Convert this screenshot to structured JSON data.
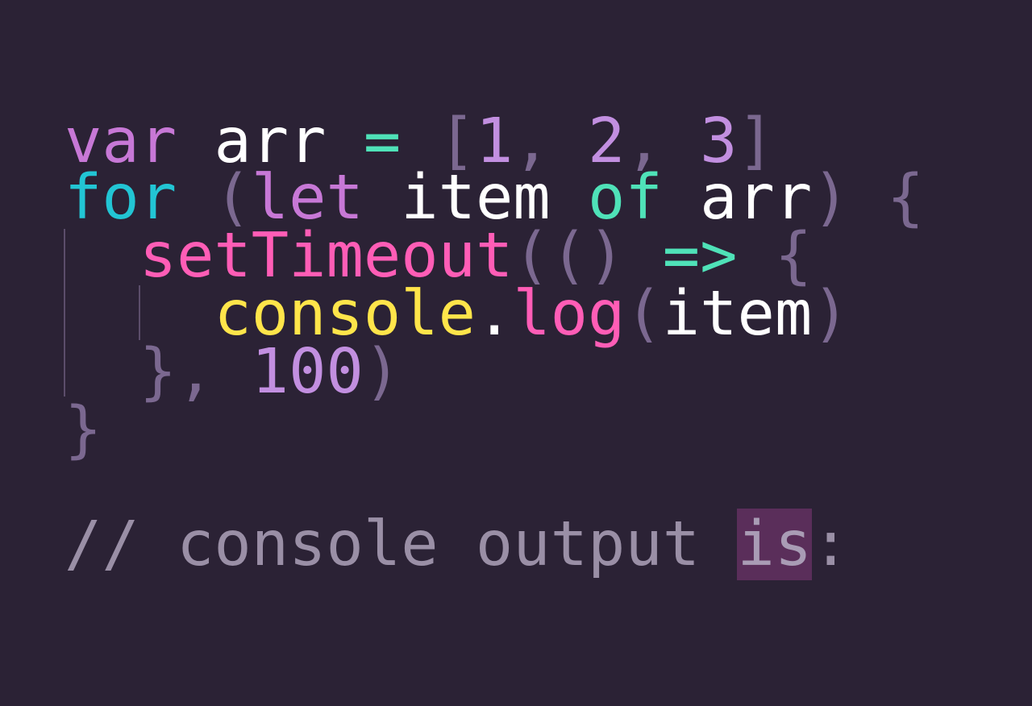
{
  "editor": {
    "background": "#2b2235",
    "code": {
      "line1": {
        "kw": "var",
        "s1": " ",
        "name": "arr",
        "s2": " ",
        "op": "=",
        "s3": " ",
        "lb": "[",
        "n1": "1",
        "c1": ", ",
        "n2": "2",
        "c2": ", ",
        "n3": "3",
        "rb": "]"
      },
      "line2": {
        "kw": "for",
        "s1": " ",
        "lp": "(",
        "let": "let",
        "s2": " ",
        "item": "item",
        "s3": " ",
        "of": "of",
        "s4": " ",
        "arr": "arr",
        "rp": ")",
        "s5": " ",
        "lb": "{"
      },
      "line3": {
        "indent": "  ",
        "fn": "setTimeout",
        "p1": "((",
        "p2": ")",
        "s1": " ",
        "arrow": "=>",
        "s2": " ",
        "lb": "{"
      },
      "line4": {
        "indent": "    ",
        "obj": "console",
        "dot": ".",
        "fn": "log",
        "lp": "(",
        "arg": "item",
        "rp": ")"
      },
      "line5": {
        "indent": "  ",
        "rb": "},",
        "s1": " ",
        "num": "100",
        "rp": ")"
      },
      "line6": {
        "rb": "}"
      },
      "comment": {
        "pre": "// console output ",
        "highlight": "is",
        "post": ":"
      }
    },
    "colors": {
      "keyword_var": "#c778d6",
      "keyword_for": "#22c5d4",
      "keyword_of": "#4fe2b8",
      "operator": "#4fe2b8",
      "number": "#c28fe0",
      "punctuation": "#7b6890",
      "function": "#ff5db6",
      "object": "#ffe54a",
      "identifier": "#ffffff",
      "comment": "#9a8fa6",
      "highlight_bg": "#5a2e5a"
    }
  }
}
